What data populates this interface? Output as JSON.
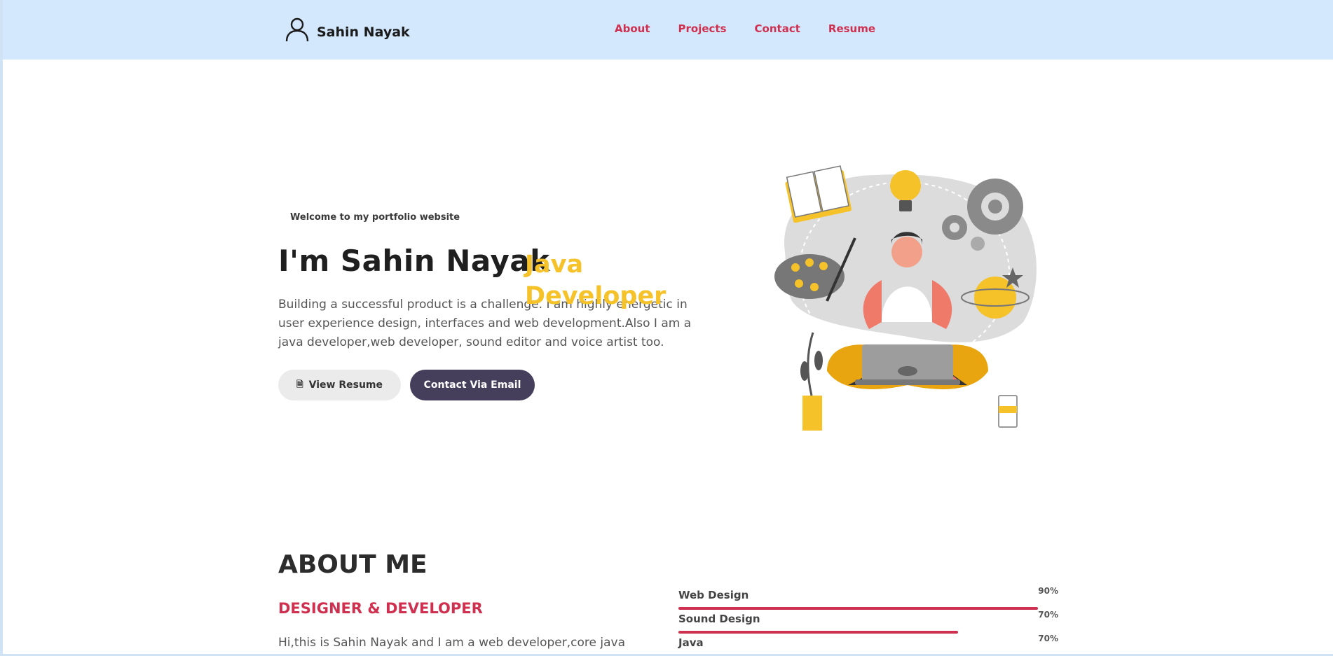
{
  "header": {
    "brand_icon": "user-icon",
    "brand_name": "Sahin Nayak",
    "nav": [
      {
        "label": "About"
      },
      {
        "label": "Projects"
      },
      {
        "label": "Contact"
      },
      {
        "label": "Resume"
      }
    ]
  },
  "hero": {
    "welcome": "Welcome to my portfolio website",
    "title": "I'm Sahin Nayak",
    "role": "Java Developer",
    "description": "Building a successful product is a challenge. I am highly energetic in user experience design, interfaces and web development.Also I am a java developer,web developer, sound editor and voice artist too.",
    "resume_button": "View Resume",
    "resume_icon": "document-icon",
    "email_button": "Contact Via Email"
  },
  "about": {
    "title": "ABOUT ME",
    "subtitle": "DESIGNER & DEVELOPER",
    "text": "Hi,this is Sahin Nayak and I am a web developer,core java"
  },
  "skills": [
    {
      "name": "Web Design",
      "percent_label": "90%",
      "level": 0.9
    },
    {
      "name": "Sound Design",
      "percent_label": "70%",
      "level": 0.7
    },
    {
      "name": "Java",
      "percent_label": "70%",
      "level": 0.7
    }
  ],
  "colors": {
    "header_bg": "#d3e7fd",
    "accent_red": "#d0304f",
    "accent_yellow": "#f5c22a",
    "button_dark": "#453f5b"
  }
}
